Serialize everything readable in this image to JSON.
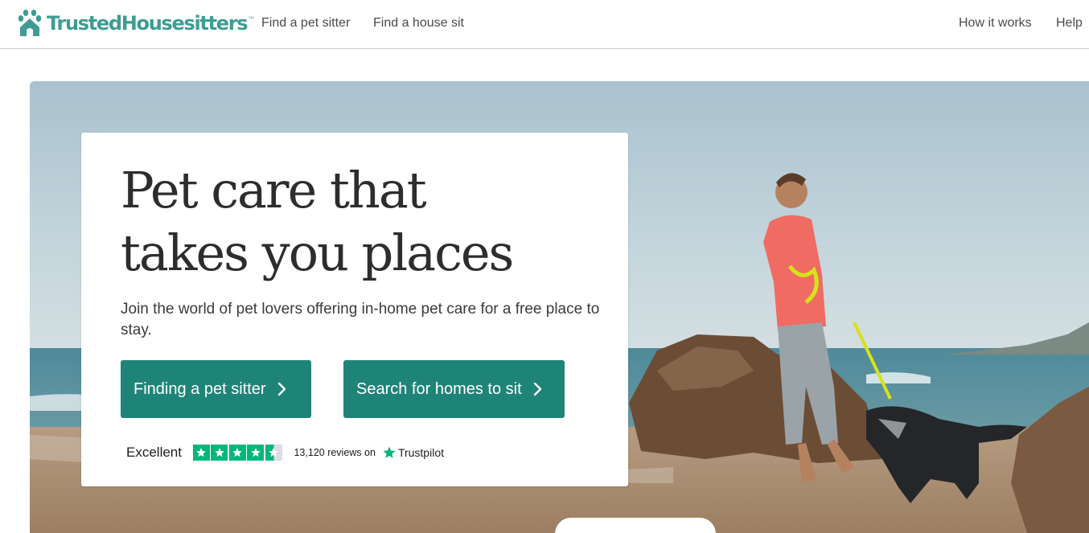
{
  "header": {
    "brand": "TrustedHousesitters",
    "trademark": "™",
    "nav_left": [
      "Find a pet sitter",
      "Find a house sit"
    ],
    "nav_right": [
      "How it works",
      "Help"
    ]
  },
  "hero": {
    "headline_line1": "Pet care that",
    "headline_line2": "takes you places",
    "subtext": "Join the world of pet lovers offering in-home pet care for a free place to stay.",
    "cta_sitter": "Finding a pet sitter",
    "cta_homes": "Search for homes to sit",
    "rating_label": "Excellent",
    "rating_stars": 4.5,
    "reviews_text": "13,120 reviews on",
    "review_brand": "Trustpilot"
  },
  "colors": {
    "brand": "#3e9c93",
    "cta": "#1f8478",
    "trustpilot_star": "#00b67a"
  },
  "icons": [
    "paw-house-logo-icon",
    "chevron-right-icon",
    "star-icon",
    "trustpilot-star-icon"
  ]
}
